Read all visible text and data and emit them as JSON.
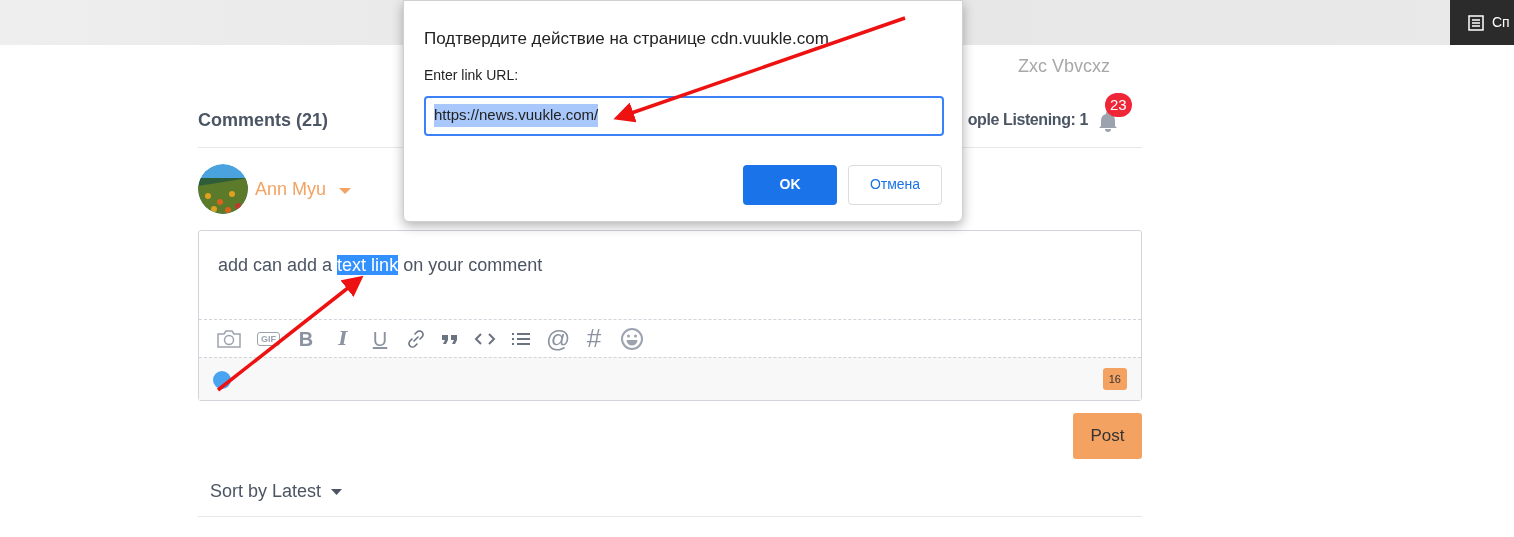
{
  "browser_bar": {
    "right_label": "Сп"
  },
  "page_tab": "Zxc Vbvcxz",
  "comments": {
    "title": "Comments (21)",
    "listening": "ople Listening: 1",
    "notifications": "23"
  },
  "user": {
    "name": "Ann Myu"
  },
  "editor": {
    "segments": [
      {
        "text": "add can add a ",
        "selected": false
      },
      {
        "text": "text link",
        "selected": true
      },
      {
        "text": " on your comment",
        "selected": false
      }
    ],
    "toolbar": [
      {
        "kind": "icon"
      },
      {
        "kind": "gif",
        "text": "GIF"
      },
      {
        "kind": "glyph",
        "text": "B"
      },
      {
        "kind": "glyph",
        "text": "I"
      },
      {
        "kind": "glyph",
        "text": "U"
      },
      {
        "kind": "icon"
      },
      {
        "kind": "icon"
      },
      {
        "kind": "icon"
      },
      {
        "kind": "icon"
      },
      {
        "kind": "glyph",
        "text": "@"
      },
      {
        "kind": "glyph",
        "text": "#"
      },
      {
        "kind": "icon"
      }
    ],
    "char_count": "16"
  },
  "post_button": "Post",
  "sort": "Sort by Latest",
  "dialog": {
    "title": "Подтвердите действие на странице cdn.vuukle.com",
    "label": "Enter link URL:",
    "value": "https://news.vuukle.com/",
    "value_selected": true,
    "buttons": [
      {
        "label": "OK",
        "primary": true
      },
      {
        "label": "Отмена",
        "primary": false
      }
    ]
  },
  "annotations": [
    {
      "kind": "arrow"
    },
    {
      "kind": "arrow"
    }
  ]
}
